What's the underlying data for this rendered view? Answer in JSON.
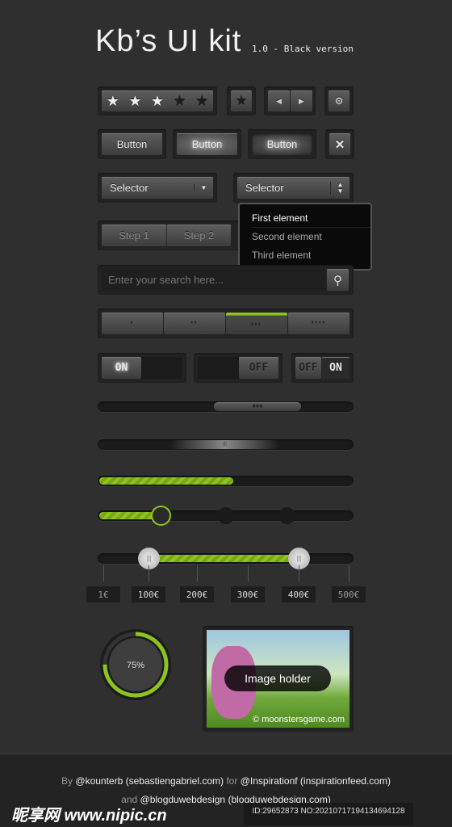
{
  "header": {
    "title": "Kb’s UI kit",
    "subtitle": "1.0 - Black version"
  },
  "rating": {
    "value": 3,
    "max": 5
  },
  "buttons": [
    "Button",
    "Button",
    "Button"
  ],
  "selectors": [
    "Selector",
    "Selector"
  ],
  "dropdown": {
    "items": [
      "First element",
      "Second element",
      "Third element"
    ],
    "selected": 0
  },
  "steps": [
    "Step 1",
    "Step 2"
  ],
  "search": {
    "placeholder": "Enter your search here..."
  },
  "segments": {
    "labels": [
      "•",
      "••",
      "•••",
      "••••"
    ],
    "active": 2,
    "accent": "#8dc31e"
  },
  "toggles": {
    "on": "ON",
    "off": "OFF"
  },
  "progress": {
    "value": 0.53
  },
  "step_slider": {
    "value": 0.25,
    "steps": 4
  },
  "range": {
    "labels": [
      "1€",
      "100€",
      "200€",
      "300€",
      "400€",
      "500€"
    ],
    "low": "100€",
    "high": "400€"
  },
  "circle": {
    "label": "75%",
    "value": 0.75
  },
  "image": {
    "label": "Image holder",
    "credit": "© moonstersgame.com"
  },
  "footer": {
    "line1_by": "By",
    "line1_author": "@kounterb (sebastiengabriel.com)",
    "line1_for": "for",
    "line1_client": "@Inspirationf (inspirationfeed.com)",
    "line2_and": "and",
    "line2_client": "@blogduwebdesign (blogduwebdesign.com)"
  },
  "watermark": {
    "logo": "昵享网 www.nipic.cn",
    "id": "ID:29652873 NO:20210717194134694128"
  }
}
